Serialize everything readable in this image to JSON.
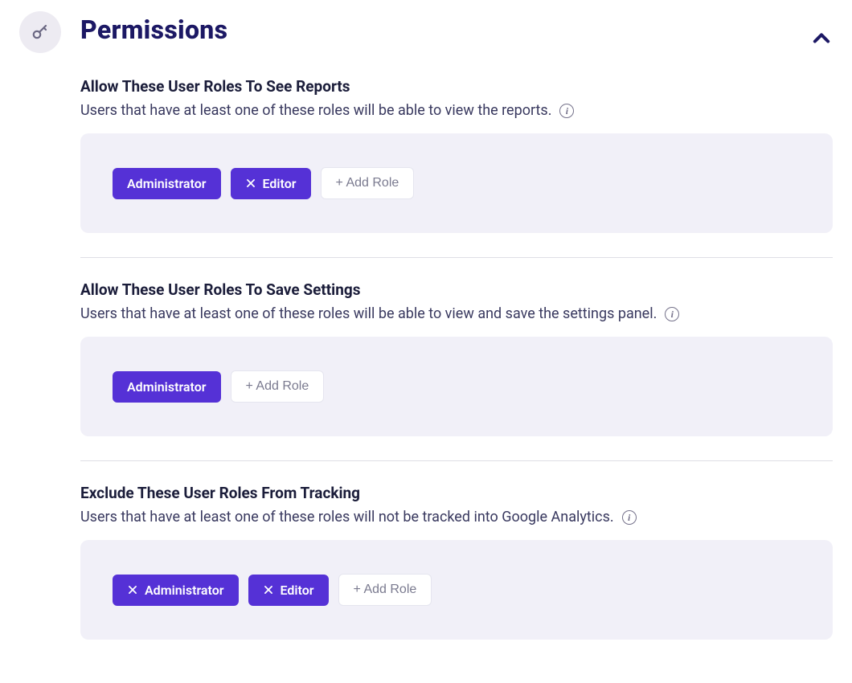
{
  "header": {
    "title": "Permissions"
  },
  "sections": [
    {
      "title": "Allow These User Roles To See Reports",
      "description": "Users that have at least one of these roles will be able to view the reports.",
      "roles": [
        {
          "label": "Administrator",
          "removable": false
        },
        {
          "label": "Editor",
          "removable": true
        }
      ],
      "addLabel": "+ Add Role"
    },
    {
      "title": "Allow These User Roles To Save Settings",
      "description": "Users that have at least one of these roles will be able to view and save the settings panel.",
      "roles": [
        {
          "label": "Administrator",
          "removable": false
        }
      ],
      "addLabel": "+ Add Role"
    },
    {
      "title": "Exclude These User Roles From Tracking",
      "description": "Users that have at least one of these roles will not be tracked into Google Analytics.",
      "roles": [
        {
          "label": "Administrator",
          "removable": true
        },
        {
          "label": "Editor",
          "removable": true
        }
      ],
      "addLabel": "+ Add Role"
    }
  ]
}
